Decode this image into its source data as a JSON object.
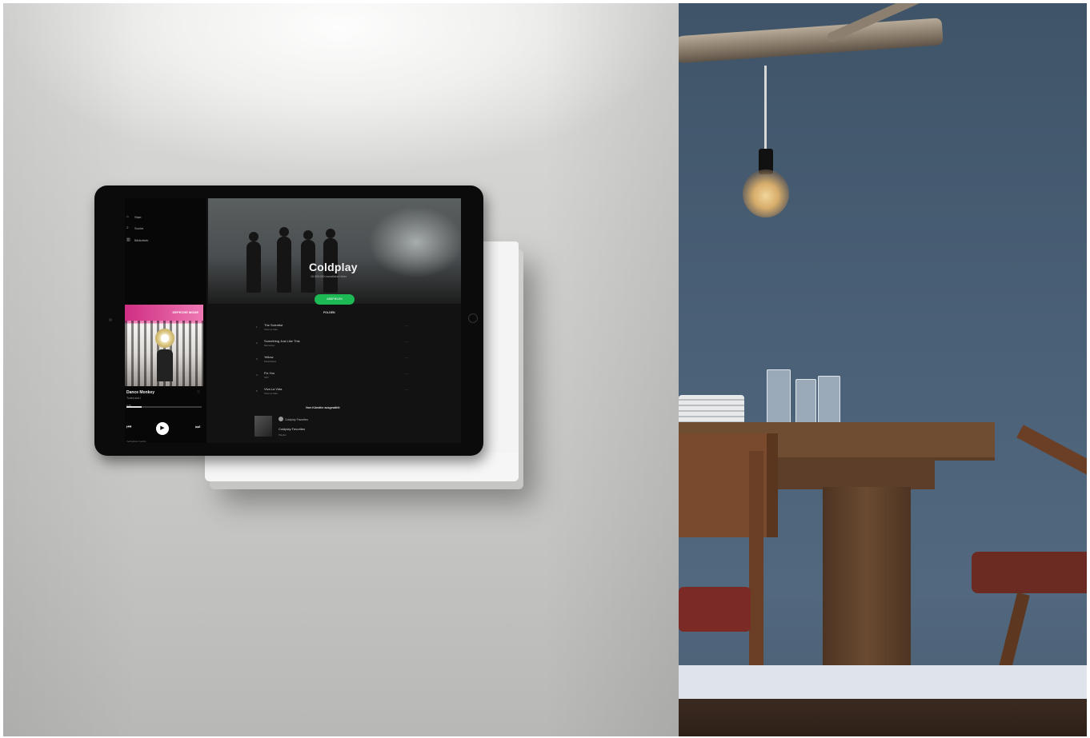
{
  "scene": {
    "wall_color": "#d6d6d4",
    "room_wall_color": "#4a6076",
    "spotify_green": "#1db954"
  },
  "sidebar": {
    "items": [
      {
        "icon": "home-icon",
        "label": "Start"
      },
      {
        "icon": "search-icon",
        "label": "Suche"
      },
      {
        "icon": "library-icon",
        "label": "Bibliothek"
      }
    ],
    "album_text": "DEPECHE MODE",
    "now_playing_title": "Dance Monkey",
    "now_playing_artist": "Tones and I",
    "progress_time": "0:45",
    "progress_fraction": 0.2,
    "devices_text": "Verfügbare Geräte"
  },
  "artist": {
    "name": "Coldplay",
    "subtitle": "15.000.000 monatliche Hörer",
    "play_label": "ABSPIELEN",
    "follow_label": "FOLGEN",
    "tracks": [
      {
        "num": "1",
        "title": "The Scientist",
        "sub": "Viva La Vida"
      },
      {
        "num": "2",
        "title": "Something Just Like This",
        "sub": "Memories"
      },
      {
        "num": "3",
        "title": "Yellow",
        "sub": "Parachutes"
      },
      {
        "num": "4",
        "title": "Fix You",
        "sub": "X&Y"
      },
      {
        "num": "5",
        "title": "Viva La Vida",
        "sub": "Viva La Vida"
      }
    ],
    "popular_heading": "Vom Künstler ausgewählt",
    "popular_line1": "Coldplay Favorites",
    "popular_line2": "Coldplay Favorites",
    "popular_line3": "Playlist"
  }
}
